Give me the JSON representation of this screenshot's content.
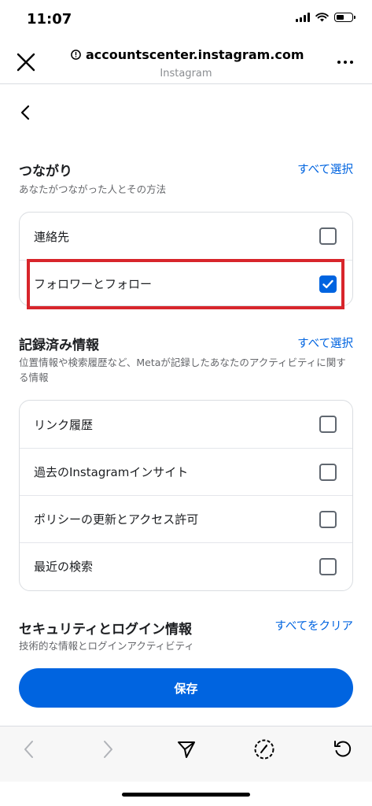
{
  "status_bar": {
    "time": "11:07"
  },
  "browser": {
    "url": "accountscenter.instagram.com",
    "site_name": "Instagram"
  },
  "sections": [
    {
      "title": "つながり",
      "description": "あなたがつながった人とその方法",
      "action": "すべて選択",
      "options": [
        {
          "label": "連絡先",
          "checked": false
        },
        {
          "label": "フォロワーとフォロー",
          "checked": true
        }
      ]
    },
    {
      "title": "記録済み情報",
      "description": "位置情報や検索履歴など、Metaが記録したあなたのアクティビティに関する情報",
      "action": "すべて選択",
      "options": [
        {
          "label": "リンク履歴",
          "checked": false
        },
        {
          "label": "過去のInstagramインサイト",
          "checked": false
        },
        {
          "label": "ポリシーの更新とアクセス許可",
          "checked": false
        },
        {
          "label": "最近の検索",
          "checked": false
        }
      ]
    },
    {
      "title": "セキュリティとログイン情報",
      "description": "技術的な情報とログインアクティビティ",
      "action": "すべてをクリア"
    }
  ],
  "save_button": "保存",
  "colors": {
    "accent": "#0064e0",
    "highlight": "#d8252b"
  },
  "icons": {
    "close": "close-icon",
    "info": "info-icon",
    "more": "more-icon",
    "back": "chevron-left-icon",
    "checkbox": "checkmark-icon",
    "toolbar": [
      "back-arrow-icon",
      "forward-arrow-icon",
      "share-icon",
      "compass-icon",
      "reload-icon"
    ]
  }
}
